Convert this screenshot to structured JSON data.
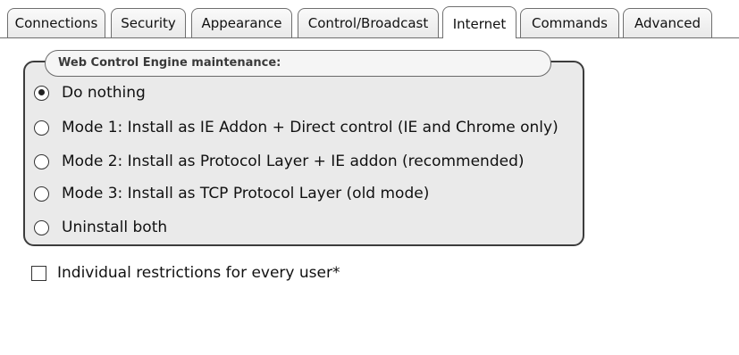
{
  "tabs": [
    {
      "label": "Connections",
      "active": false
    },
    {
      "label": "Security",
      "active": false
    },
    {
      "label": "Appearance",
      "active": false
    },
    {
      "label": "Control/Broadcast",
      "active": false
    },
    {
      "label": "Internet",
      "active": true
    },
    {
      "label": "Commands",
      "active": false
    },
    {
      "label": "Advanced",
      "active": false
    }
  ],
  "maintenance": {
    "title": "Web Control Engine maintenance:",
    "selected_index": 0,
    "options": [
      {
        "label": "Do nothing",
        "checked": true
      },
      {
        "label": "Mode 1: Install as IE Addon + Direct control (IE and Chrome only)",
        "checked": false
      },
      {
        "label": "Mode 2: Install as Protocol Layer + IE addon (recommended)",
        "checked": false
      },
      {
        "label": "Mode 3: Install as TCP Protocol Layer (old mode)",
        "checked": false
      },
      {
        "label": "Uninstall both",
        "checked": false
      }
    ]
  },
  "restrictions": {
    "label": "Individual restrictions for every user*",
    "checked": false
  }
}
